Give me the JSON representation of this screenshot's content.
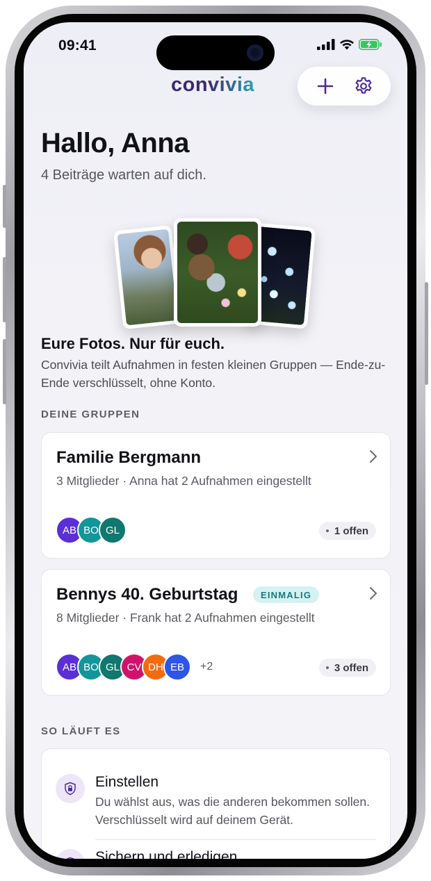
{
  "status_bar": {
    "time": "09:41"
  },
  "header": {
    "logo_text": "convivia",
    "add_icon": "plus-icon",
    "settings_icon": "gear-icon"
  },
  "greeting": {
    "title": "Hallo, Anna",
    "subtitle": "4 Beiträge warten auf dich."
  },
  "intro": {
    "title": "Eure Fotos. Nur für euch.",
    "body": "Convivia teilt Aufnahmen in festen kleinen Gruppen — Ende-zu-Ende verschlüsselt, ohne Konto."
  },
  "groups": {
    "section_label": "DEINE GRUPPEN",
    "items": [
      {
        "title": "Familie Bergmann",
        "badge": "",
        "meta": "3 Mitglieder · Anna hat 2 Aufnahmen eingestellt",
        "members": [
          {
            "initials": "AB",
            "color": "#5b2fd6"
          },
          {
            "initials": "BO",
            "color": "#12969a"
          },
          {
            "initials": "GL",
            "color": "#11776f"
          }
        ],
        "more": "",
        "open": "1 offen"
      },
      {
        "title": "Bennys 40. Geburtstag",
        "badge": "EINMALIG",
        "meta": "8 Mitglieder · Frank hat 2 Aufnahmen eingestellt",
        "members": [
          {
            "initials": "AB",
            "color": "#5b2fd6"
          },
          {
            "initials": "BO",
            "color": "#12969a"
          },
          {
            "initials": "GL",
            "color": "#11776f"
          },
          {
            "initials": "CV",
            "color": "#d0136a"
          },
          {
            "initials": "DH",
            "color": "#f26b0f"
          },
          {
            "initials": "EB",
            "color": "#2d55e6"
          }
        ],
        "more": "+2",
        "open": "3 offen"
      }
    ]
  },
  "how_it_works": {
    "section_label": "SO LÄUFT ES",
    "steps": [
      {
        "icon": "lock-icon",
        "title": "Einstellen",
        "body": "Du wählst aus, was die anderen bekommen sollen. Verschlüsselt wird auf deinem Gerät."
      },
      {
        "icon": "shield-icon",
        "title": "Sichern und erledigen",
        "body": ""
      }
    ]
  },
  "colors": {
    "accent": "#4a2a9a",
    "background": "#f2f2f7",
    "badge_bg": "#d6f1f1",
    "badge_text": "#177a7e"
  }
}
